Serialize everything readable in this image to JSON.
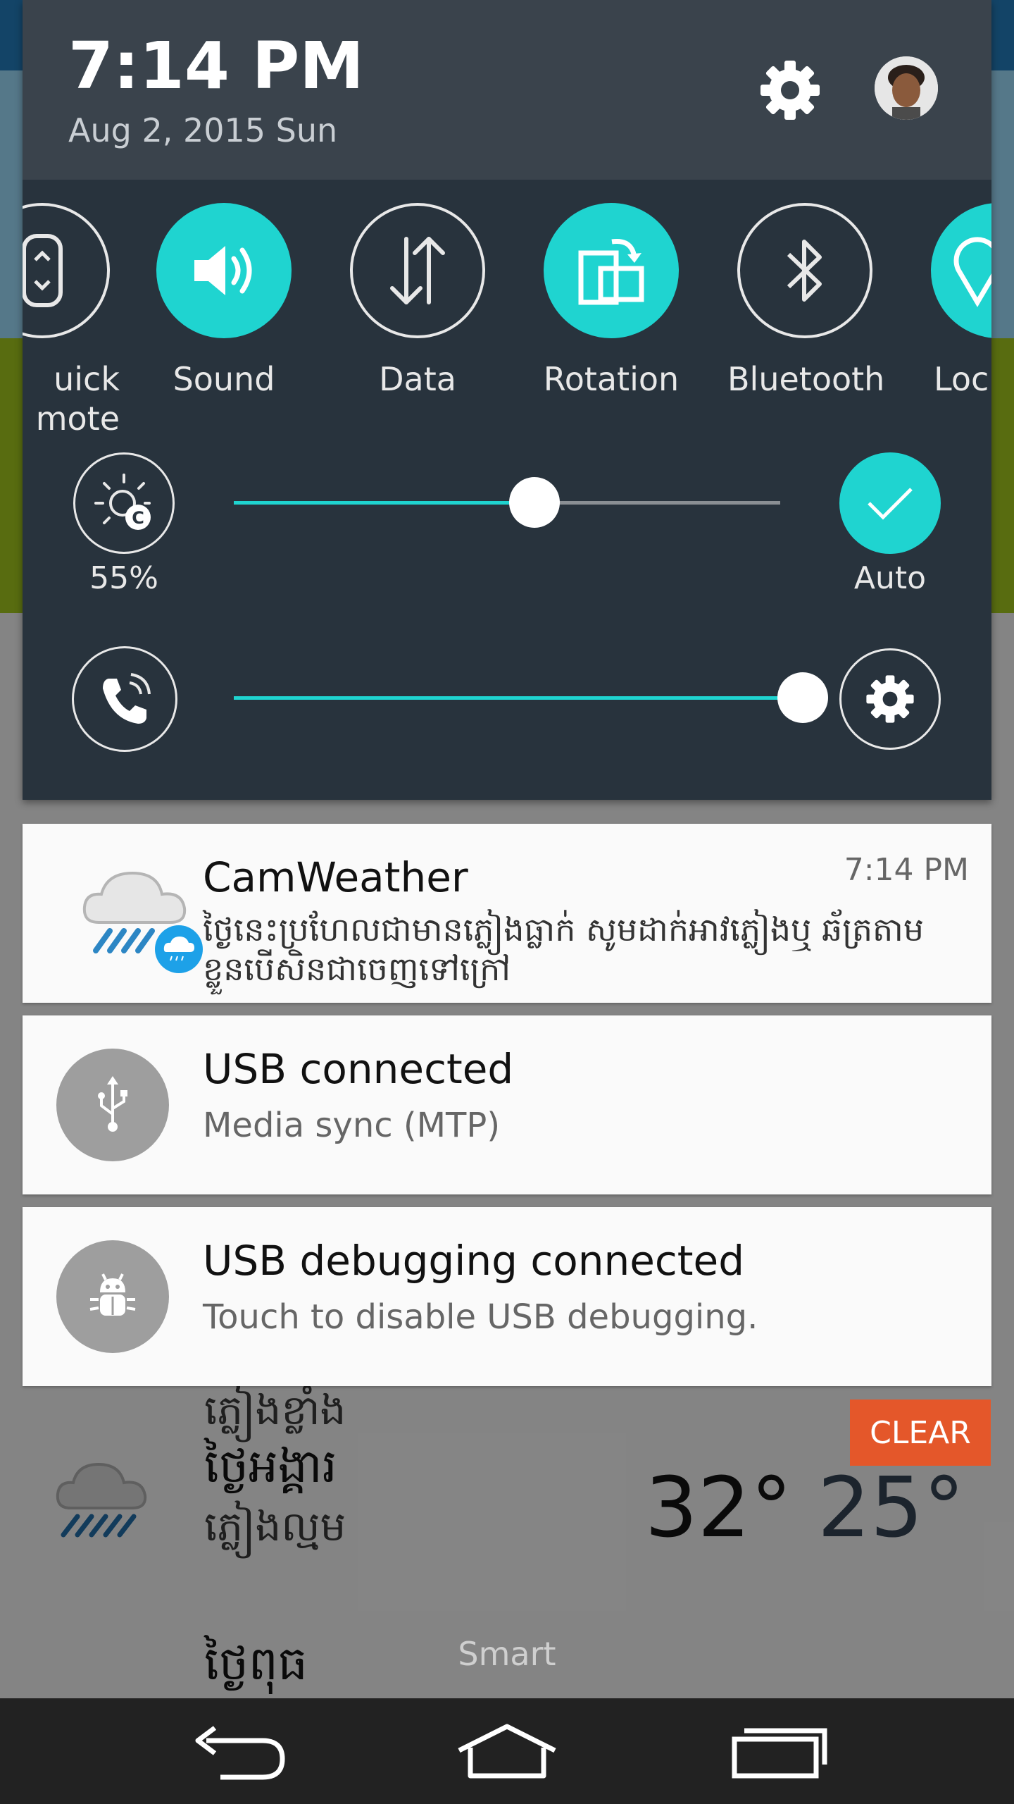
{
  "status": {
    "time": "7:14 PM",
    "date": "Aug 2, 2015 Sun"
  },
  "quick_settings": {
    "tiles": [
      {
        "label": "Quick\nmemo",
        "label_shown": "uick\nmote",
        "icon": "quick-memo-icon",
        "active": false
      },
      {
        "label": "Sound",
        "icon": "speaker-icon",
        "active": true
      },
      {
        "label": "Data",
        "icon": "data-arrows-icon",
        "active": false
      },
      {
        "label": "Rotation",
        "icon": "rotation-icon",
        "active": true
      },
      {
        "label": "Bluetooth",
        "icon": "bluetooth-icon",
        "active": false
      },
      {
        "label": "Loc",
        "icon": "location-icon",
        "active": true
      }
    ],
    "brightness": {
      "value_label": "55%",
      "value": 0.55,
      "auto_label": "Auto",
      "auto_on": true
    },
    "ringtone_volume": {
      "value": 1.0
    }
  },
  "notifications": [
    {
      "app": "CamWeather",
      "time": "7:14 PM",
      "text": "ថ្ងៃនេះប្រហែលជាមានភ្លៀងធ្លាក់ សូមដាក់អាវភ្លៀងឬ ឆ័ត្រតាមខ្លួនបើសិនជាចេញទៅក្រៅ",
      "icon": "weather-rain-icon"
    },
    {
      "title": "USB connected",
      "subtitle": "Media sync (MTP)",
      "icon": "usb-icon"
    },
    {
      "title": "USB debugging connected",
      "subtitle": "Touch to disable USB debugging.",
      "icon": "android-bug-icon"
    }
  ],
  "clear_label": "CLEAR",
  "background": {
    "rows": [
      {
        "day": "ថ្ងៃអង្គារ",
        "desc": "ភ្លៀងល្មម",
        "high": "32°",
        "low": "25°"
      }
    ],
    "partial_day": "ថ្ងៃពុធ",
    "partial_desc": "ភ្លៀងខ្លាំង",
    "smart_label": "Smart"
  },
  "colors": {
    "accent": "#1fd4d0",
    "shade_bg": "#28333d",
    "header_bg": "#3a434c",
    "clear_bg": "#e4572a"
  }
}
